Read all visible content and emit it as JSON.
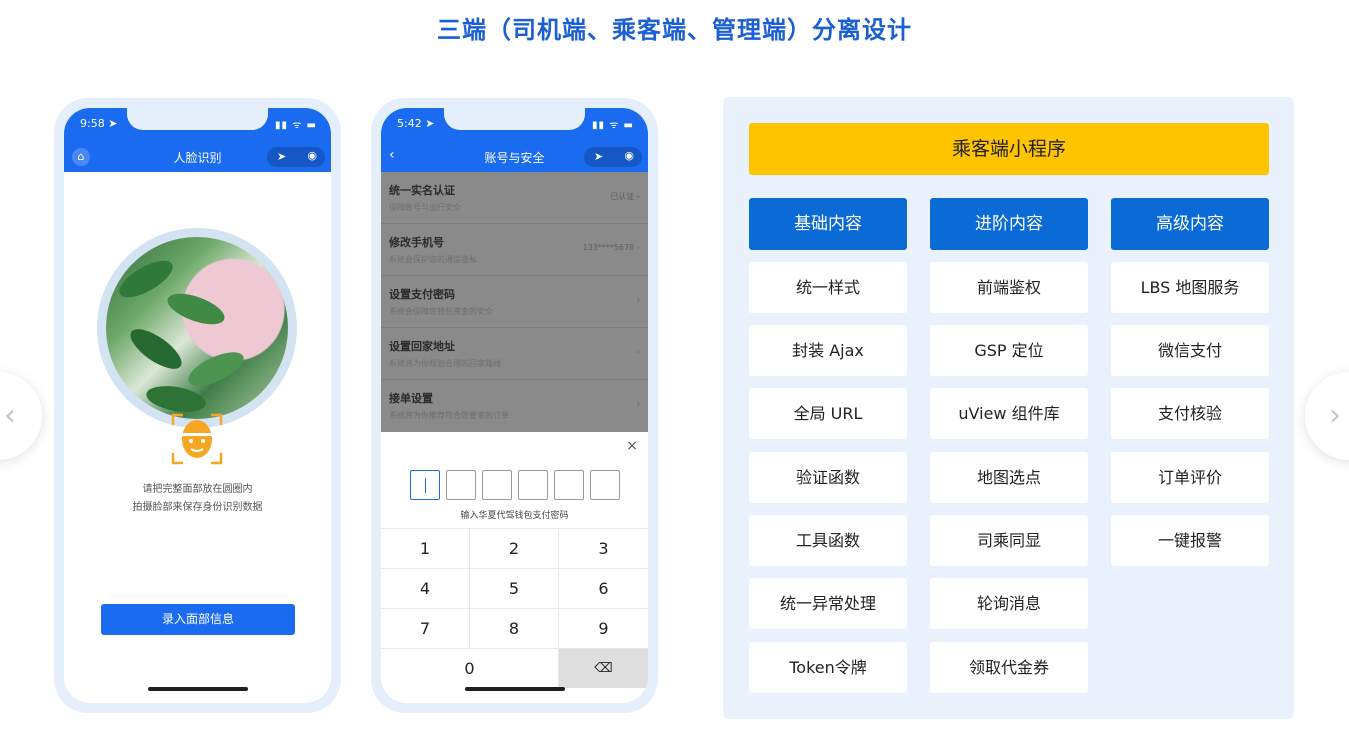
{
  "page_title": "三端（司机端、乘客端、管理端）分离设计",
  "nav": {
    "prev_icon": "chevron-left-icon",
    "next_icon": "chevron-right-icon"
  },
  "phone1": {
    "time": "9:58 ➤",
    "signal": "▮▮ ᯤ ▬",
    "nav_title": "人脸识别",
    "home_icon": "⌂",
    "capsule_left": "➤",
    "capsule_right": "◉",
    "hint_line1": "请把完整面部放在圆圈内",
    "hint_line2": "拍摄脸部来保存身份识别数据",
    "button_label": "录入面部信息",
    "accent": "#1a6bf0"
  },
  "phone2": {
    "time": "5:42 ➤",
    "signal": "▮▮ ᯤ ▬",
    "back_icon": "‹",
    "nav_title": "账号与安全",
    "capsule_left": "➤",
    "capsule_right": "◉",
    "settings": [
      {
        "title": "统一实名认证",
        "sub": "保障账号与出行安全",
        "right": "已认证 ›"
      },
      {
        "title": "修改手机号",
        "sub": "系统会保护您的通信隐私",
        "right": "133****5678 ›"
      },
      {
        "title": "设置支付密码",
        "sub": "系统会保障您钱包资金的安全",
        "right": "›"
      },
      {
        "title": "设置回家地址",
        "sub": "系统将为你规划合理的回家路线",
        "right": "›"
      },
      {
        "title": "接单设置",
        "sub": "系统将为你推荐符合您要求的订单",
        "right": "›"
      }
    ],
    "close": "×",
    "pay_hint": "输入华夏代驾钱包支付密码",
    "keys": [
      "1",
      "2",
      "3",
      "4",
      "5",
      "6",
      "7",
      "8",
      "9",
      "0",
      "⌫"
    ]
  },
  "panel": {
    "header": "乘客端小程序",
    "header_color": "#ffc400",
    "column_color": "#0a6ad6",
    "columns": [
      {
        "title": "基础内容",
        "items": [
          "统一样式",
          "封装 Ajax",
          "全局 URL",
          "验证函数",
          "工具函数",
          "统一异常处理",
          "Token令牌"
        ]
      },
      {
        "title": "进阶内容",
        "items": [
          "前端鉴权",
          "GSP 定位",
          "uView 组件库",
          "地图选点",
          "司乘同显",
          "轮询消息",
          "领取代金券"
        ]
      },
      {
        "title": "高级内容",
        "items": [
          "LBS 地图服务",
          "微信支付",
          "支付核验",
          "订单评价",
          "一键报警"
        ]
      }
    ]
  }
}
